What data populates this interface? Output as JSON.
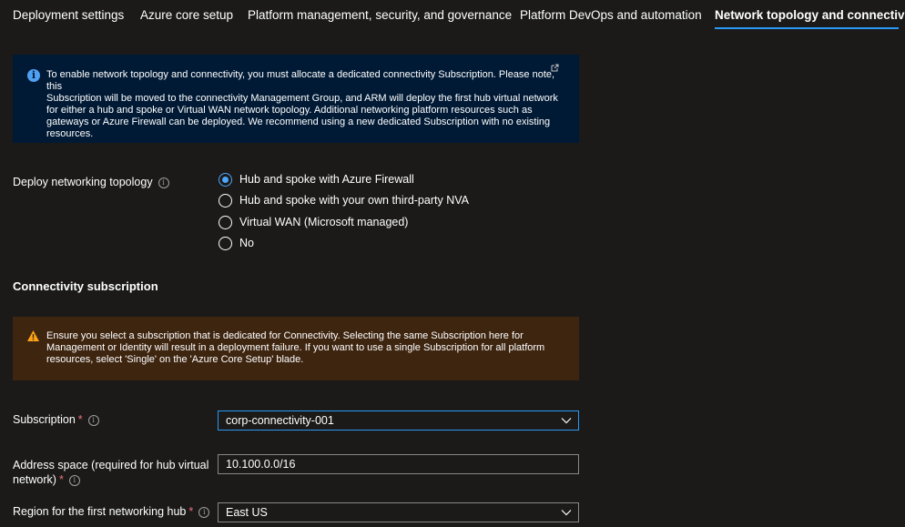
{
  "tabs": [
    {
      "label": "Deployment settings"
    },
    {
      "label": "Azure core setup"
    },
    {
      "label": "Platform management, security, and governance"
    },
    {
      "label": "Platform DevOps and automation"
    },
    {
      "label": "Network topology and connectivity",
      "active": true
    }
  ],
  "info_banner": {
    "icon": "info-icon",
    "lines": [
      "To enable network topology and connectivity, you must allocate a dedicated connectivity Subscription. Please note, this",
      "Subscription will be moved to the connectivity Management Group, and ARM will deploy the first hub virtual network",
      "for either a hub and spoke or Virtual WAN  network topology. Additional networking platform resources such as",
      "gateways or Azure Firewall can be deployed. We recommend using a new dedicated Subscription with no existing",
      "resources."
    ]
  },
  "topology": {
    "label": "Deploy networking topology",
    "options": [
      {
        "label": "Hub and spoke with Azure Firewall",
        "checked": true
      },
      {
        "label": "Hub and spoke with your own third-party NVA",
        "checked": false
      },
      {
        "label": "Virtual WAN (Microsoft managed)",
        "checked": false
      },
      {
        "label": "No",
        "checked": false
      }
    ]
  },
  "connectivity": {
    "heading": "Connectivity subscription",
    "warning": {
      "icon": "warning-icon",
      "lines": [
        "Ensure you select a subscription that is dedicated for Connectivity. Selecting the same Subscription here for",
        "Management or Identity will result in a deployment failure. If you want to use a single Subscription for all platform",
        "resources, select 'Single' on the 'Azure Core Setup' blade."
      ]
    },
    "subscription": {
      "label": "Subscription",
      "required_mark": "*",
      "value": "corp-connectivity-001"
    },
    "address_space": {
      "label_line1": "Address space (required for hub virtual",
      "label_line2": "network)",
      "required_mark": "*",
      "value": "10.100.0.0/16"
    },
    "region": {
      "label": "Region for the first networking hub",
      "required_mark": "*",
      "value": "East US"
    }
  },
  "colors": {
    "accent": "#2899f5",
    "info_bg": "#001a35",
    "warning_bg": "#3e2510",
    "required": "#f1707b"
  }
}
